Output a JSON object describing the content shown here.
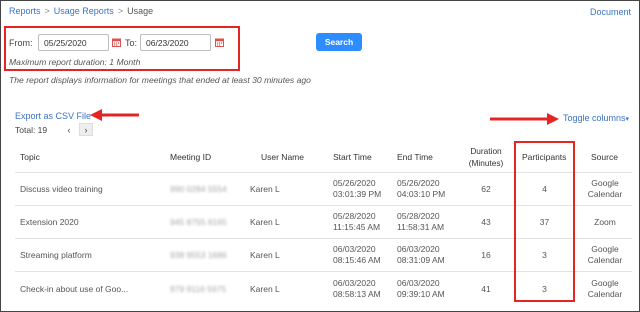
{
  "breadcrumb": {
    "items": [
      "Reports",
      "Usage Reports"
    ],
    "current": "Usage",
    "separator": ">"
  },
  "documentation_label": "Document",
  "filter": {
    "from_label": "From:",
    "from_value": "05/25/2020",
    "to_label": "To:",
    "to_value": "06/23/2020",
    "max_duration_note": "Maximum report duration: 1 Month"
  },
  "search_label": "Search",
  "info_note": "The report displays information for meetings that ended at least 30 minutes ago",
  "export_label": "Export as CSV File",
  "total_label": "Total: 19",
  "pager": {
    "prev": "‹",
    "next": "›"
  },
  "toggle_columns_label": "Toggle columns",
  "table": {
    "headers": {
      "topic": "Topic",
      "meeting_id": "Meeting ID",
      "user_name": "User Name",
      "start_time": "Start Time",
      "end_time": "End Time",
      "duration_1": "Duration",
      "duration_2": "(Minutes)",
      "participants": "Participants",
      "source": "Source"
    },
    "rows": [
      {
        "topic": "Discuss video training",
        "meeting_id": "990 0284 5554",
        "user": "Karen L",
        "start_date": "05/26/2020",
        "start_time": "03:01:39 PM",
        "end_date": "05/26/2020",
        "end_time": "04:03:10 PM",
        "duration": "62",
        "participants": "4",
        "source_1": "Google",
        "source_2": "Calendar"
      },
      {
        "topic": "Extension 2020",
        "meeting_id": "945 8755 6165",
        "user": "Karen L",
        "start_date": "05/28/2020",
        "start_time": "11:15:45 AM",
        "end_date": "05/28/2020",
        "end_time": "11:58:31 AM",
        "duration": "43",
        "participants": "37",
        "source_1": "Zoom",
        "source_2": ""
      },
      {
        "topic": "Streaming platform",
        "meeting_id": "938 9553 1686",
        "user": "Karen L",
        "start_date": "06/03/2020",
        "start_time": "08:15:46 AM",
        "end_date": "06/03/2020",
        "end_time": "08:31:09 AM",
        "duration": "16",
        "participants": "3",
        "source_1": "Google",
        "source_2": "Calendar"
      },
      {
        "topic": "Check-in about use of Goo...",
        "meeting_id": "979 9116 5975",
        "user": "Karen L",
        "start_date": "06/03/2020",
        "start_time": "08:58:13 AM",
        "end_date": "06/03/2020",
        "end_time": "09:39:10 AM",
        "duration": "41",
        "participants": "3",
        "source_1": "Google",
        "source_2": "Calendar"
      }
    ]
  },
  "colors": {
    "link": "#3b73c5",
    "primary_button": "#2d8cff",
    "annotation_red": "#e52525"
  },
  "icons": [
    "calendar-icon",
    "chevron-left-icon",
    "chevron-right-icon",
    "caret-down-icon",
    "arrow-annotation"
  ]
}
